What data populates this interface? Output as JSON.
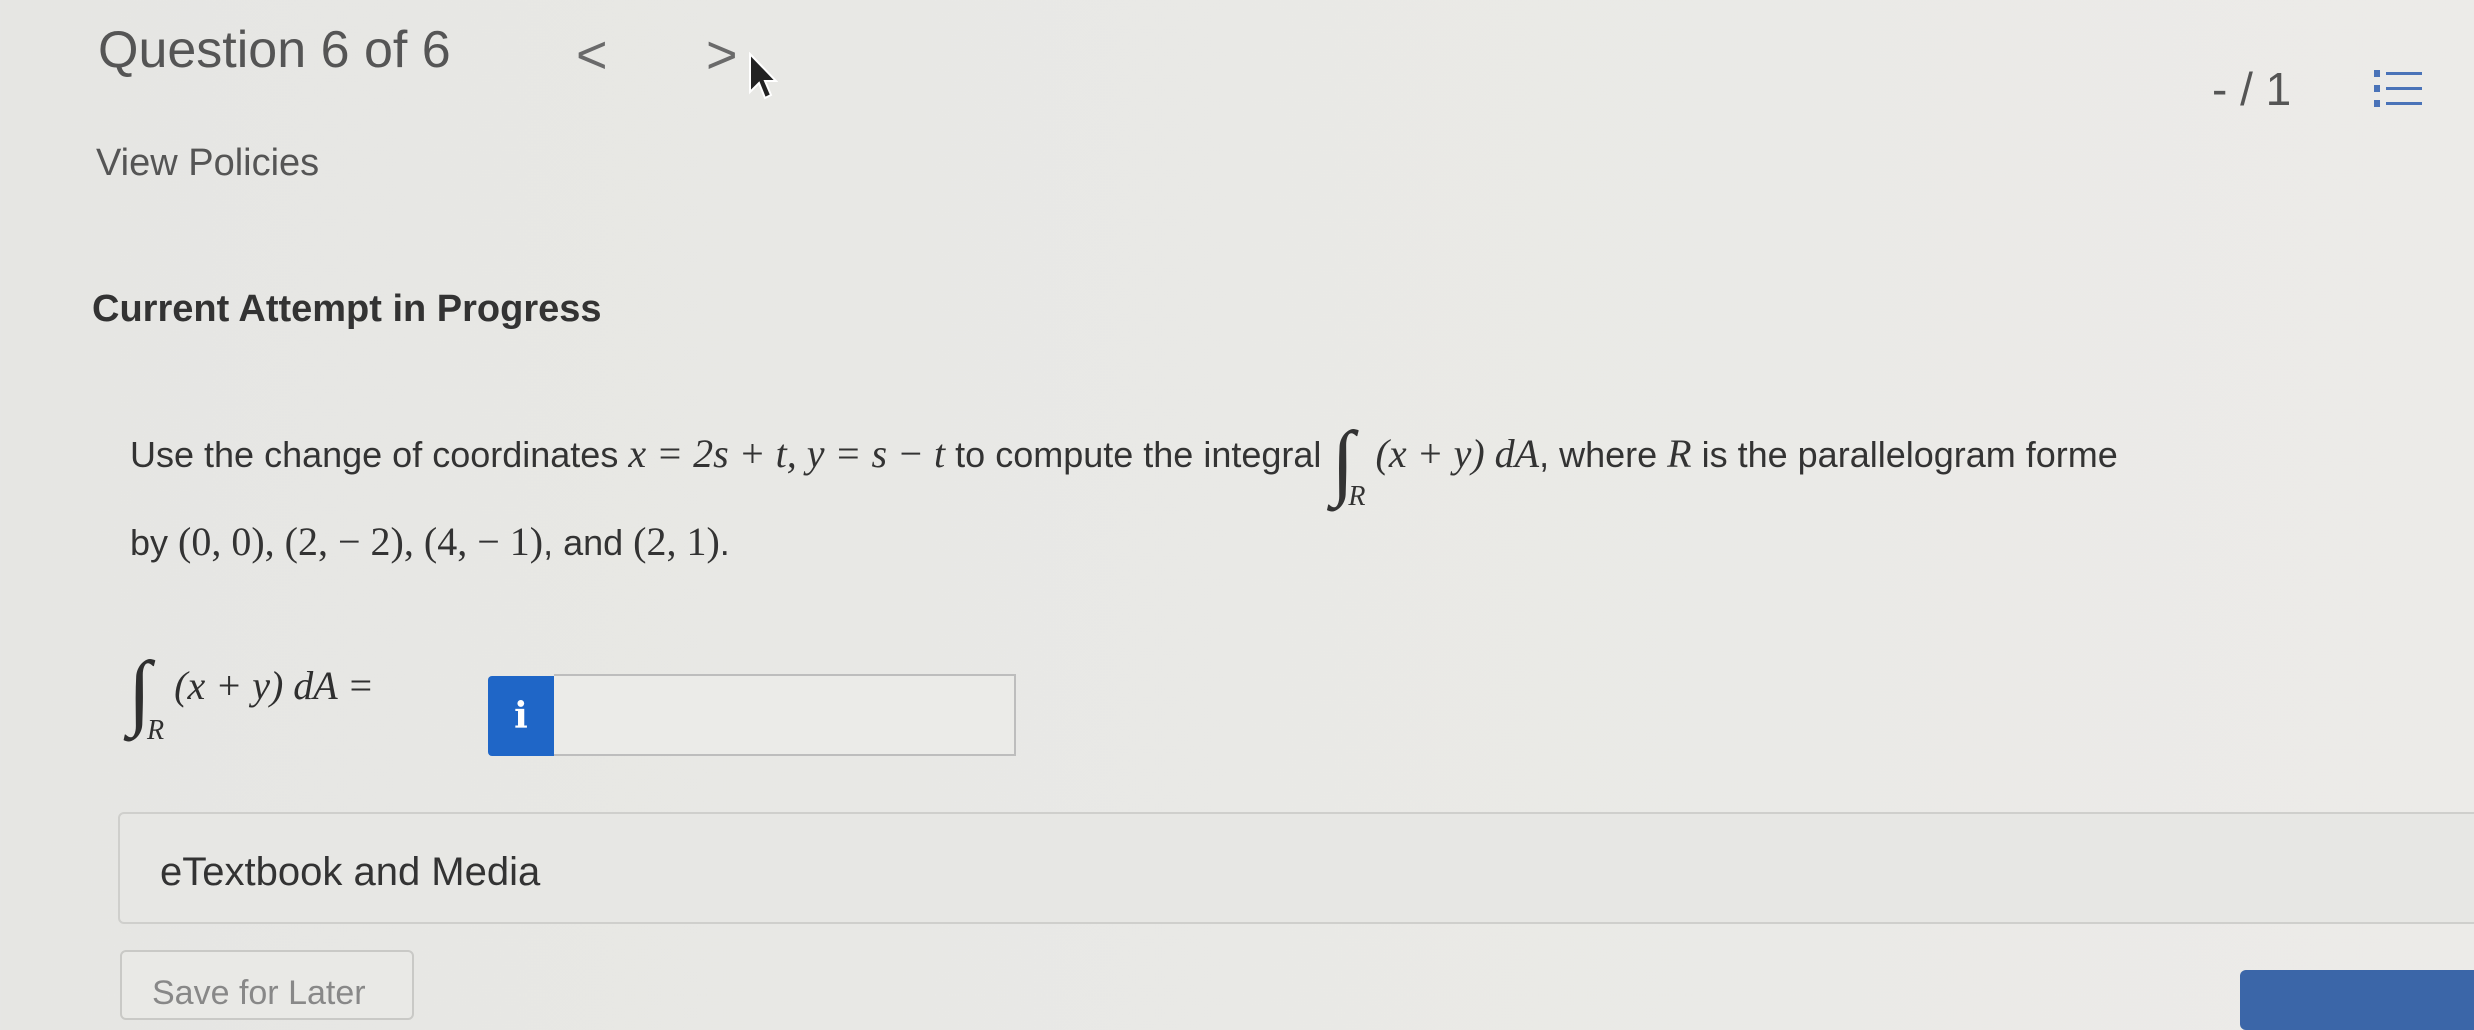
{
  "header": {
    "question_title": "Question 6 of 6",
    "prev_glyph": "<",
    "next_glyph": ">",
    "score": "- / 1",
    "list_icon": "numbered-list-icon"
  },
  "links": {
    "view_policies": "View Policies"
  },
  "attempt_heading": "Current Attempt in Progress",
  "question": {
    "t1": "Use the change of coordinates ",
    "m1": "x = 2s + t, y = s − t",
    "t2": " to compute the integral ",
    "int_symbol": "∫",
    "sub_R": "R",
    "m2": "(x + y) dA",
    "t3": ", where ",
    "m3": "R",
    "t4": " is the parallelogram forme",
    "t5": "by ",
    "m4": "(0, 0), (2, − 2), (4, − 1)",
    "t6": ", and ",
    "m5": "(2, 1)",
    "t7": "."
  },
  "answer": {
    "int_symbol": "∫",
    "sub_R": "R",
    "expr": "(x + y) dA =",
    "info_glyph": "i",
    "value": ""
  },
  "etextbook_label": "eTextbook and Media",
  "save_label": "Save for Later",
  "colors": {
    "info_blue": "#1f66c7",
    "submit_blue": "#3b66a8"
  }
}
